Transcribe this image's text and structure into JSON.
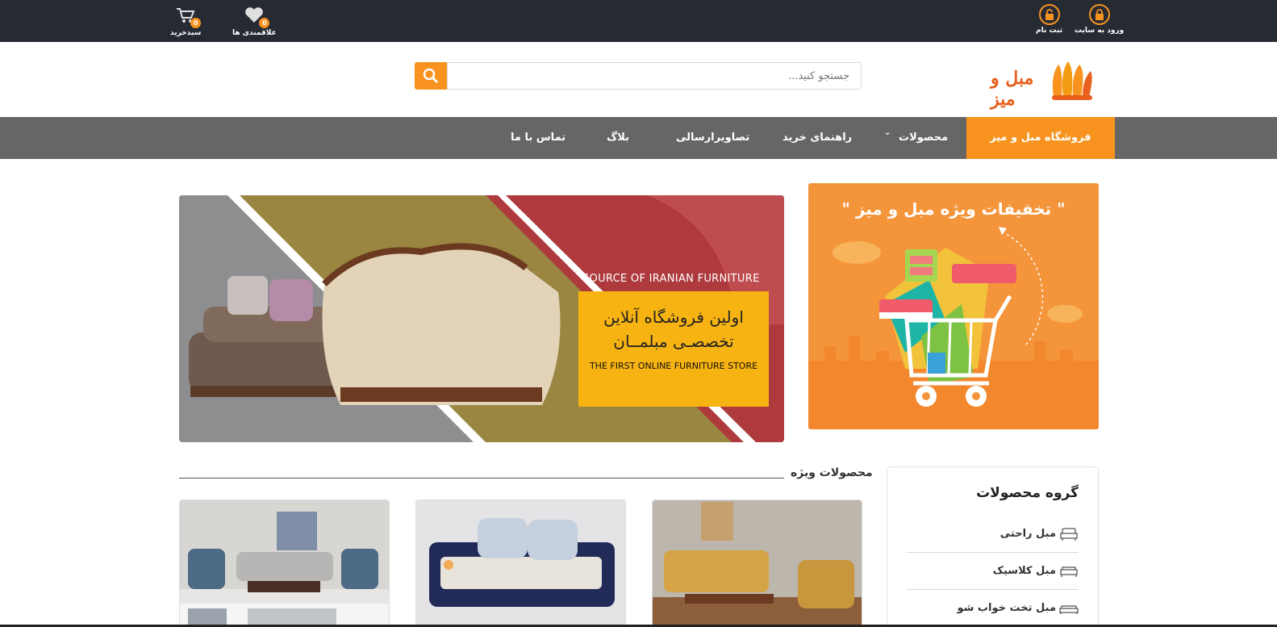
{
  "topbar": {
    "login_label": "ورود به سایت",
    "register_label": "ثبت نام",
    "wishlist_label": "علاقمندی ها",
    "wishlist_count": "0",
    "cart_label": "سبدخرید",
    "cart_count": "0",
    "accent": "#f7931e"
  },
  "header": {
    "logo_text": "مبل و میز",
    "search_placeholder": "جستجو کنید..."
  },
  "nav": {
    "items": [
      {
        "label": "فروشگاه مبل و میز",
        "active": true
      },
      {
        "label": "محصولات",
        "has_dropdown": true
      },
      {
        "label": "راهنمای خرید"
      },
      {
        "label": "تصاویرارسالی"
      },
      {
        "label": "بلاگ"
      },
      {
        "label": "تماس با ما"
      }
    ]
  },
  "promo": {
    "title": "\" تخفیفات ویژه مبل و میز \""
  },
  "slider": {
    "source_text": "SOURCE OF IRANIAN FURNITURE",
    "line1": "اولین فروشگاه آنلاین",
    "line2": "تخصصـی مبلمــان",
    "english": "THE FIRST ONLINE FURNITURE STORE"
  },
  "featured": {
    "title": "محصولات ویژه"
  },
  "sidebar": {
    "title": "گروه محصولات",
    "items": [
      {
        "label": "مبل راحتی",
        "icon": "armchair-icon"
      },
      {
        "label": "مبل کلاسیک",
        "icon": "sofa-icon"
      },
      {
        "label": "مبل تخت خواب شو",
        "icon": "sofa-bed-icon"
      }
    ]
  }
}
